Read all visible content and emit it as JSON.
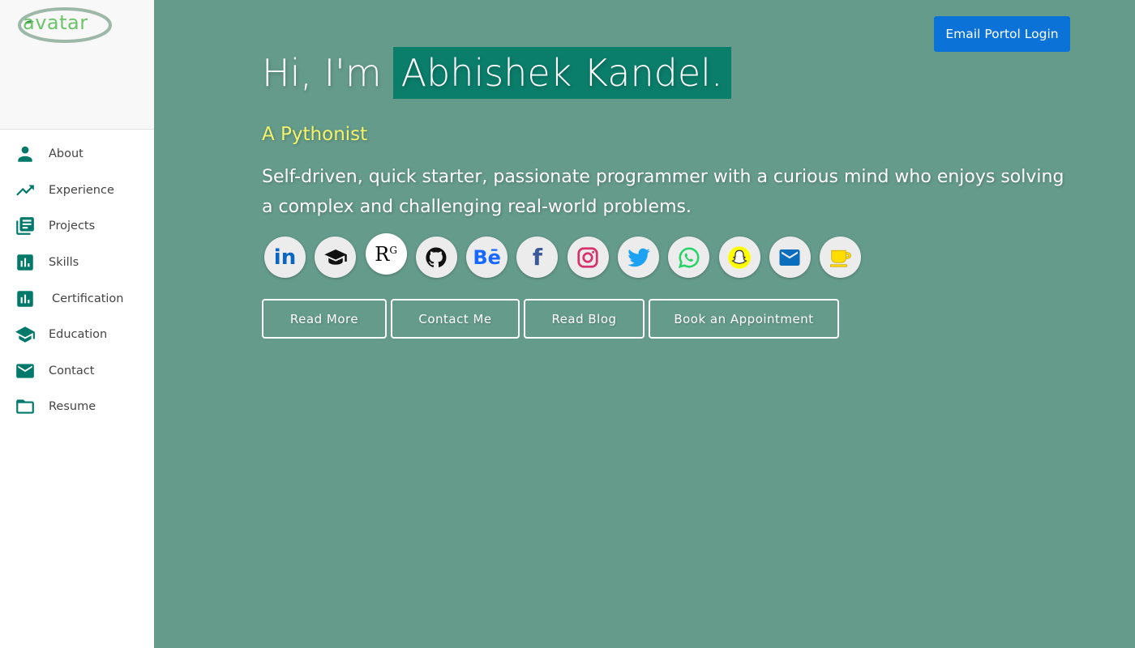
{
  "sidebar": {
    "logo_text": "avatar",
    "items": [
      {
        "label": "About",
        "icon": "person-icon"
      },
      {
        "label": "Experience",
        "icon": "trending-up-icon"
      },
      {
        "label": "Projects",
        "icon": "library-books-icon"
      },
      {
        "label": "Skills",
        "icon": "bar-chart-icon"
      },
      {
        "label": "Certification",
        "icon": "bar-chart-icon"
      },
      {
        "label": "Education",
        "icon": "school-icon"
      },
      {
        "label": "Contact",
        "icon": "email-icon"
      },
      {
        "label": "Resume",
        "icon": "folder-icon"
      }
    ]
  },
  "header": {
    "login_label": "Email Portol Login"
  },
  "hero": {
    "greeting": "Hi, I'm",
    "name": "Abhishek Kandel.",
    "subtitle": "A Pythonist",
    "description": "Self-driven, quick starter, passionate programmer with a curious mind who enjoys solving a complex and challenging real-world problems."
  },
  "socials": [
    {
      "name": "linkedin-icon",
      "glyph": "in",
      "color": "#0a66c2"
    },
    {
      "name": "graduation-cap-icon",
      "glyph": "",
      "color": "#111111"
    },
    {
      "name": "researchgate-icon",
      "glyph": "R",
      "sup": "G",
      "color": "#000000"
    },
    {
      "name": "github-icon",
      "glyph": "",
      "color": "#111111"
    },
    {
      "name": "behance-icon",
      "glyph": "Bē",
      "color": "#1769ff"
    },
    {
      "name": "facebook-icon",
      "glyph": "f",
      "color": "#3b5998"
    },
    {
      "name": "instagram-icon",
      "glyph": "",
      "color": "#d6336c"
    },
    {
      "name": "twitter-icon",
      "glyph": "",
      "color": "#1da1f2"
    },
    {
      "name": "whatsapp-icon",
      "glyph": "",
      "color": "#25d366"
    },
    {
      "name": "snapchat-icon",
      "glyph": "",
      "color": "#fffc00"
    },
    {
      "name": "email-icon",
      "glyph": "",
      "color": "#0a6ebd"
    },
    {
      "name": "coffee-icon",
      "glyph": "",
      "color": "#ffdd00"
    }
  ],
  "actions": [
    {
      "label": "Read More"
    },
    {
      "label": "Contact Me"
    },
    {
      "label": "Read Blog"
    },
    {
      "label": "Book an Appointment"
    }
  ],
  "colors": {
    "background": "#659b8b",
    "accent": "#00796b",
    "name_highlight": "#0b7d6b",
    "subtitle": "#f3f36b",
    "login_button": "#0b72d8"
  }
}
